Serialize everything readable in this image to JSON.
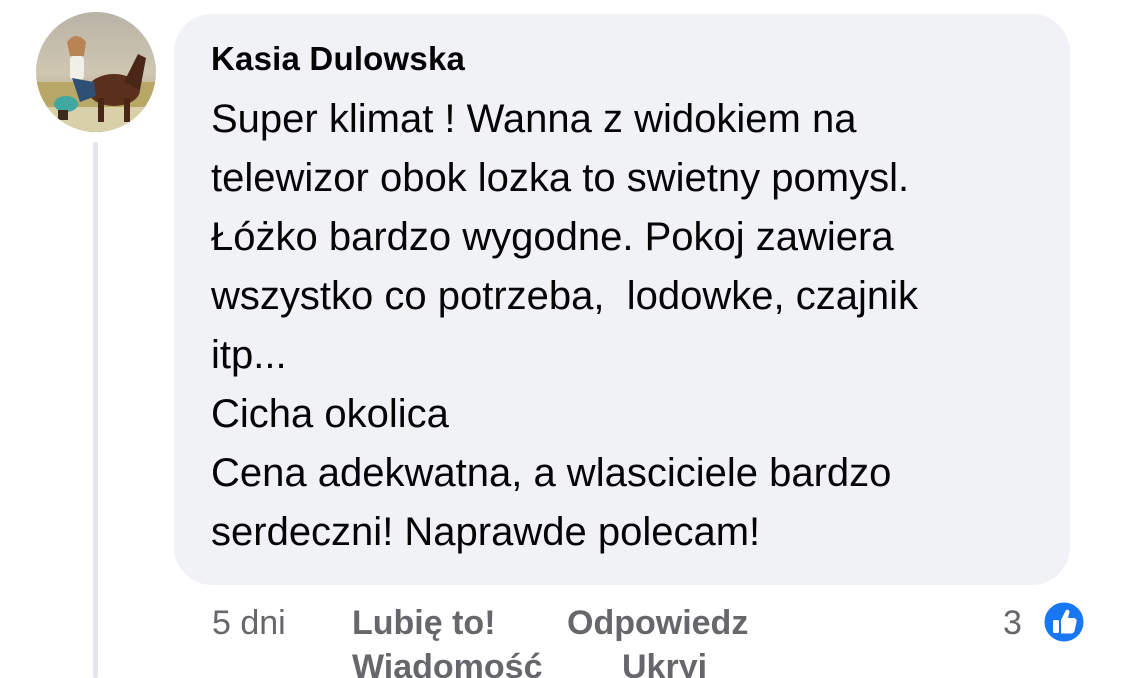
{
  "comment": {
    "author": "Kasia Dulowska",
    "lines": [
      "Super klimat ! Wanna z widokiem na",
      "telewizor obok lozka to swietny pomysl.",
      "Łóżko bardzo wygodne. Pokoj zawiera",
      "wszystko co potrzeba,  lodowke, czajnik",
      "itp...",
      "Cicha okolica",
      "Cena adekwatna, a wlasciciele bardzo",
      "serdeczni! Naprawde polecam!"
    ]
  },
  "actions": {
    "time": "5 dni",
    "like_label": "Lubię to!",
    "reply_label": "Odpowiedz",
    "message_label": "Wiadomość",
    "hide_label": "Ukryj",
    "reaction_count": "3",
    "reaction_icon": "like-thumb-icon"
  },
  "colors": {
    "bubble": "#f0f2f5",
    "secondary_text": "#65676b",
    "like_blue": "#1877f2"
  }
}
